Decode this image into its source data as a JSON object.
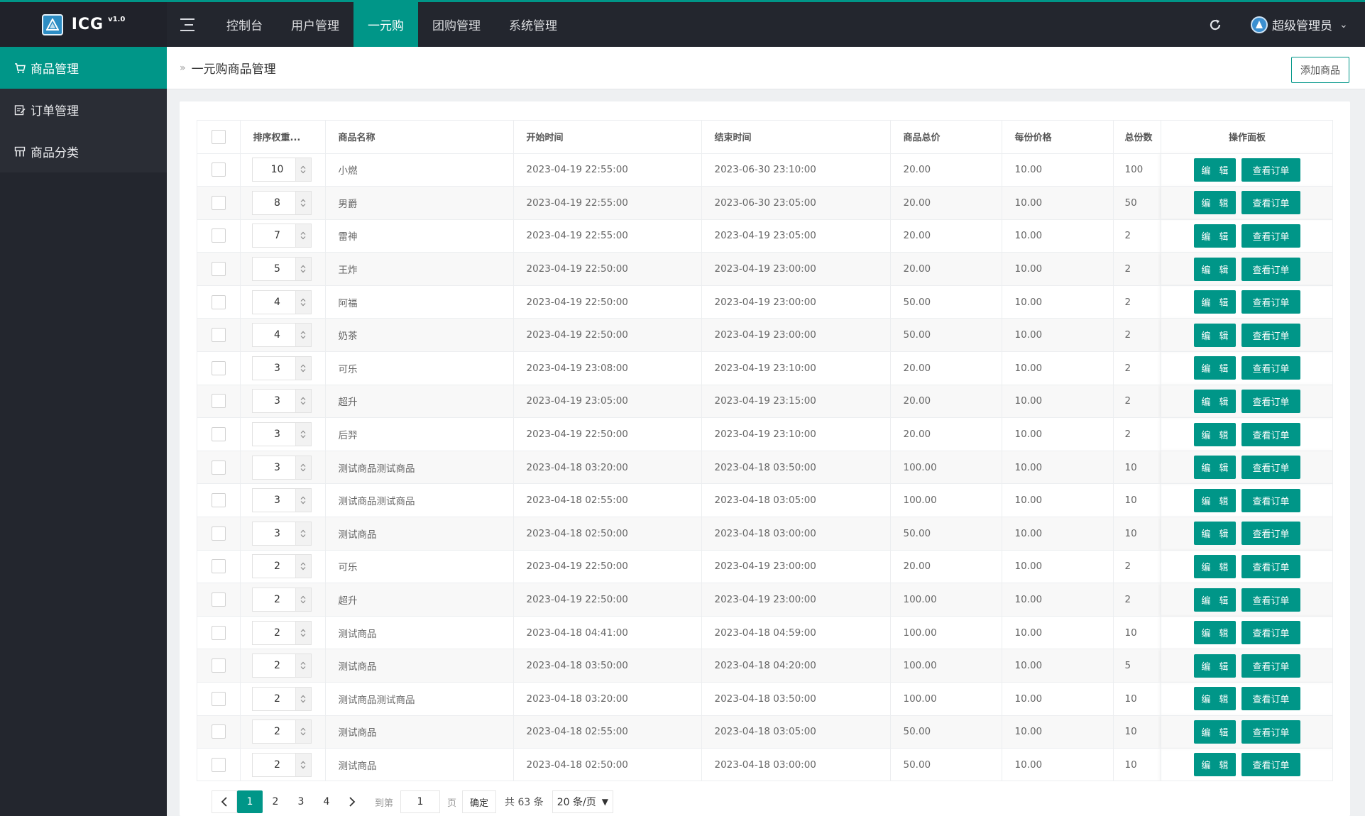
{
  "app": {
    "logo_text": "ICG",
    "version": "v1.0"
  },
  "nav": {
    "items": [
      {
        "label": "控制台"
      },
      {
        "label": "用户管理"
      },
      {
        "label": "一元购"
      },
      {
        "label": "团购管理"
      },
      {
        "label": "系统管理"
      }
    ],
    "active_index": 2,
    "user_name": "超级管理员"
  },
  "sidebar": {
    "items": [
      {
        "label": "商品管理",
        "icon": "cart-icon"
      },
      {
        "label": "订单管理",
        "icon": "order-icon"
      },
      {
        "label": "商品分类",
        "icon": "category-icon"
      }
    ],
    "active_index": 0
  },
  "page": {
    "breadcrumb": "一元购商品管理",
    "add_button": "添加商品"
  },
  "table": {
    "headers": {
      "weight": "排序权重...",
      "name": "商品名称",
      "start": "开始时间",
      "end": "结束时间",
      "total_price": "商品总价",
      "unit_price": "每份价格",
      "total_count": "总份数",
      "ops": "操作面板"
    },
    "edit_label": "编 辑",
    "orders_label": "查看订单",
    "rows": [
      {
        "weight": "10",
        "name": "小燃",
        "start": "2023-04-19 22:55:00",
        "end": "2023-06-30 23:10:00",
        "total_price": "20.00",
        "unit_price": "10.00",
        "total_count": "100"
      },
      {
        "weight": "8",
        "name": "男爵",
        "start": "2023-04-19 22:55:00",
        "end": "2023-06-30 23:05:00",
        "total_price": "20.00",
        "unit_price": "10.00",
        "total_count": "50"
      },
      {
        "weight": "7",
        "name": "雷神",
        "start": "2023-04-19 22:55:00",
        "end": "2023-04-19 23:05:00",
        "total_price": "20.00",
        "unit_price": "10.00",
        "total_count": "2"
      },
      {
        "weight": "5",
        "name": "王炸",
        "start": "2023-04-19 22:50:00",
        "end": "2023-04-19 23:00:00",
        "total_price": "20.00",
        "unit_price": "10.00",
        "total_count": "2"
      },
      {
        "weight": "4",
        "name": "阿福",
        "start": "2023-04-19 22:50:00",
        "end": "2023-04-19 23:00:00",
        "total_price": "50.00",
        "unit_price": "10.00",
        "total_count": "2"
      },
      {
        "weight": "4",
        "name": "奶茶",
        "start": "2023-04-19 22:50:00",
        "end": "2023-04-19 23:00:00",
        "total_price": "50.00",
        "unit_price": "10.00",
        "total_count": "2"
      },
      {
        "weight": "3",
        "name": "可乐",
        "start": "2023-04-19 23:08:00",
        "end": "2023-04-19 23:10:00",
        "total_price": "20.00",
        "unit_price": "10.00",
        "total_count": "2"
      },
      {
        "weight": "3",
        "name": "超升",
        "start": "2023-04-19 23:05:00",
        "end": "2023-04-19 23:15:00",
        "total_price": "20.00",
        "unit_price": "10.00",
        "total_count": "2"
      },
      {
        "weight": "3",
        "name": "后羿",
        "start": "2023-04-19 22:50:00",
        "end": "2023-04-19 23:10:00",
        "total_price": "20.00",
        "unit_price": "10.00",
        "total_count": "2"
      },
      {
        "weight": "3",
        "name": "测试商品测试商品",
        "start": "2023-04-18 03:20:00",
        "end": "2023-04-18 03:50:00",
        "total_price": "100.00",
        "unit_price": "10.00",
        "total_count": "10"
      },
      {
        "weight": "3",
        "name": "测试商品测试商品",
        "start": "2023-04-18 02:55:00",
        "end": "2023-04-18 03:05:00",
        "total_price": "100.00",
        "unit_price": "10.00",
        "total_count": "10"
      },
      {
        "weight": "3",
        "name": "测试商品",
        "start": "2023-04-18 02:50:00",
        "end": "2023-04-18 03:00:00",
        "total_price": "50.00",
        "unit_price": "10.00",
        "total_count": "10"
      },
      {
        "weight": "2",
        "name": "可乐",
        "start": "2023-04-19 22:50:00",
        "end": "2023-04-19 23:00:00",
        "total_price": "20.00",
        "unit_price": "10.00",
        "total_count": "2"
      },
      {
        "weight": "2",
        "name": "超升",
        "start": "2023-04-19 22:50:00",
        "end": "2023-04-19 23:00:00",
        "total_price": "100.00",
        "unit_price": "10.00",
        "total_count": "2"
      },
      {
        "weight": "2",
        "name": "测试商品",
        "start": "2023-04-18 04:41:00",
        "end": "2023-04-18 04:59:00",
        "total_price": "100.00",
        "unit_price": "10.00",
        "total_count": "10"
      },
      {
        "weight": "2",
        "name": "测试商品",
        "start": "2023-04-18 03:50:00",
        "end": "2023-04-18 04:20:00",
        "total_price": "100.00",
        "unit_price": "10.00",
        "total_count": "5"
      },
      {
        "weight": "2",
        "name": "测试商品测试商品",
        "start": "2023-04-18 03:20:00",
        "end": "2023-04-18 03:50:00",
        "total_price": "100.00",
        "unit_price": "10.00",
        "total_count": "10"
      },
      {
        "weight": "2",
        "name": "测试商品",
        "start": "2023-04-18 02:55:00",
        "end": "2023-04-18 03:05:00",
        "total_price": "50.00",
        "unit_price": "10.00",
        "total_count": "10"
      },
      {
        "weight": "2",
        "name": "测试商品",
        "start": "2023-04-18 02:50:00",
        "end": "2023-04-18 03:00:00",
        "total_price": "50.00",
        "unit_price": "10.00",
        "total_count": "10"
      }
    ]
  },
  "pagination": {
    "pages": [
      "1",
      "2",
      "3",
      "4"
    ],
    "current": "1",
    "jump_label": "到第",
    "jump_value": "1",
    "page_unit": "页",
    "confirm": "确定",
    "total": "共 63 条",
    "page_size": "20 条/页"
  },
  "colors": {
    "accent": "#009688",
    "topbar": "#23262e"
  }
}
